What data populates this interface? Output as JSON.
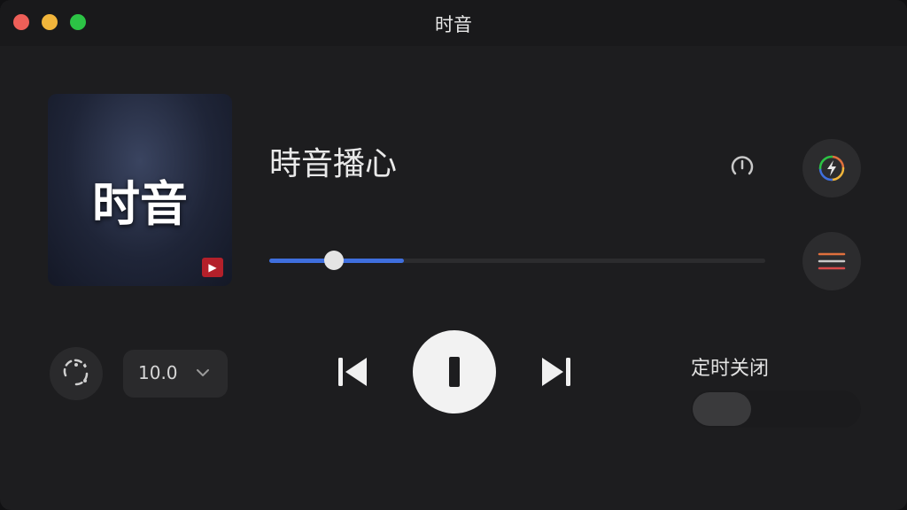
{
  "window": {
    "title": "时音"
  },
  "cover": {
    "text": "时音"
  },
  "track": {
    "title": "時音播心"
  },
  "progress": {
    "played_fraction": 0.13,
    "buffered_fraction": 0.272
  },
  "controls": {
    "rate_value": "10.0",
    "sleep_timer_label": "定时关闭",
    "sleep_timer_on": false
  },
  "icons": {
    "timer": "timer-icon",
    "effects": "effects-icon",
    "playlist": "playlist-icon",
    "speed": "speed-dial-icon",
    "previous": "previous-icon",
    "pause": "pause-icon",
    "next": "next-icon",
    "chevron": "chevron-down-icon"
  },
  "colors": {
    "accent": "#3f6fde",
    "playlist_top": "#e0703d",
    "playlist_middle": "#c9c9c9",
    "playlist_bottom": "#d84a4a"
  }
}
